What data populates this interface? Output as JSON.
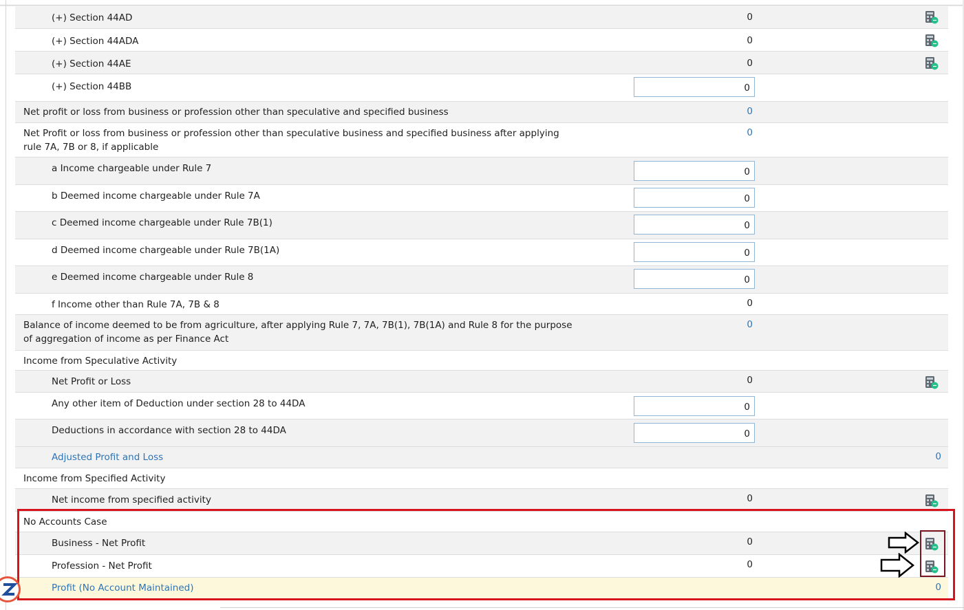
{
  "rows": [
    {
      "label": "(+) Section 44AD",
      "value": "0",
      "kind": "calc"
    },
    {
      "label": "(+) Section 44ADA",
      "value": "0",
      "kind": "calc"
    },
    {
      "label": "(+) Section 44AE",
      "value": "0",
      "kind": "calc"
    },
    {
      "label": "(+) Section 44BB",
      "value": "0",
      "kind": "input"
    },
    {
      "label": "Net profit or loss from business or profession other than speculative and specified business",
      "value": "0",
      "kind": "computed"
    },
    {
      "label": "Net Profit or loss from business or profession other than speculative business and specified business after applying rule 7A, 7B or 8, if applicable",
      "value": "0",
      "kind": "computed"
    },
    {
      "label": "a Income chargeable under Rule 7",
      "value": "0",
      "kind": "input"
    },
    {
      "label": "b Deemed income chargeable under Rule 7A",
      "value": "0",
      "kind": "input"
    },
    {
      "label": "c Deemed income chargeable under Rule 7B(1)",
      "value": "0",
      "kind": "input"
    },
    {
      "label": "d Deemed income chargeable under Rule 7B(1A)",
      "value": "0",
      "kind": "input"
    },
    {
      "label": "e Deemed income chargeable under Rule 8",
      "value": "0",
      "kind": "input"
    },
    {
      "label": "f Income other than Rule 7A, 7B & 8",
      "value": "0",
      "kind": "plain"
    },
    {
      "label": "Balance of income deemed to be from agriculture, after applying Rule 7, 7A, 7B(1), 7B(1A) and Rule 8 for the purpose of aggregation of income as per Finance Act",
      "value": "0",
      "kind": "computed"
    },
    {
      "label": "Income from Speculative Activity",
      "kind": "header"
    },
    {
      "label": "Net Profit or Loss",
      "value": "0",
      "kind": "calc"
    },
    {
      "label": "Any other item of Deduction under section 28 to 44DA",
      "value": "0",
      "kind": "input"
    },
    {
      "label": "Deductions in accordance with section 28 to 44DA",
      "value": "0",
      "kind": "input"
    },
    {
      "label": "Adjusted Profit and Loss",
      "value": "0",
      "kind": "total"
    },
    {
      "label": "Income from Specified Activity",
      "kind": "header"
    },
    {
      "label": "Net income from specified activity",
      "value": "0",
      "kind": "calc"
    },
    {
      "label": "No Accounts Case",
      "kind": "header"
    },
    {
      "label": "Business - Net Profit",
      "value": "0",
      "kind": "calc"
    },
    {
      "label": "Profession - Net Profit",
      "value": "0",
      "kind": "calc"
    },
    {
      "label": "Profit (No Account Maintained)",
      "value": "0",
      "kind": "total"
    }
  ],
  "icons": {
    "calculator": "calculator-icon",
    "arrow": "right-arrow-icon"
  },
  "colors": {
    "link": "#2e74b5",
    "highlight_border": "#d7141e",
    "icon_box_border": "#7a1520",
    "total_row_bg": "#fdf8dc"
  }
}
